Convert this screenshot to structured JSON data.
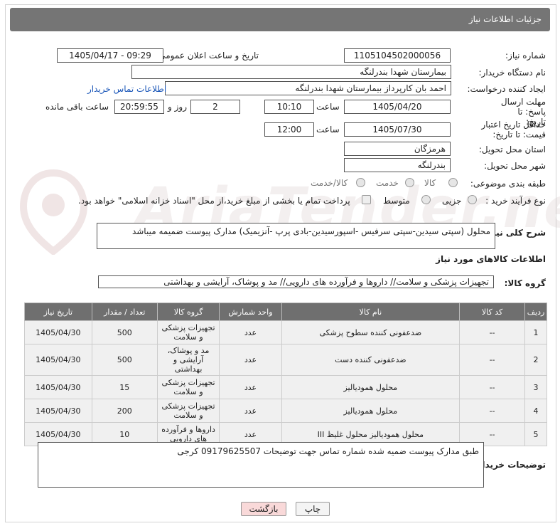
{
  "header": {
    "title": "جزئیات اطلاعات نیاز"
  },
  "form": {
    "need_number": {
      "label": "شماره نیاز:",
      "value": "1105104502000056"
    },
    "announce": {
      "label": "تاریخ و ساعت اعلان عمومی:",
      "value": "1405/04/17 - 09:29"
    },
    "buyer": {
      "label": "نام دستگاه خریدار:",
      "value": "بیمارستان شهدا بندرلنگه"
    },
    "creator": {
      "label": "ایجاد کننده درخواست:",
      "value": "احمد بان کارپرداز بیمارستان شهدا بندرلنگه",
      "contact_link": "اطلاعات تماس خریدار"
    },
    "deadline": {
      "label": "مهلت ارسال پاسخ: تا تاریخ:",
      "date": "1405/04/20",
      "time_label": "ساعت",
      "time": "10:10",
      "days": "2",
      "days_label": "روز و",
      "remaining": "20:59:55",
      "remaining_label": "ساعت باقی مانده"
    },
    "validity": {
      "label": "حداقل تاریخ اعتبار قیمت: تا تاریخ:",
      "date": "1405/07/30",
      "time_label": "ساعت",
      "time": "12:00"
    },
    "province": {
      "label": "استان محل تحویل:",
      "value": "هرمزگان"
    },
    "city": {
      "label": "شهر محل تحویل:",
      "value": "بندرلنگه"
    },
    "category": {
      "label": "طبقه بندی موضوعی:",
      "opt1": "کالا",
      "opt2": "خدمت",
      "opt3": "کالا/خدمت"
    },
    "process": {
      "label": "نوع فرآیند خرید :",
      "opt1": "جزیی",
      "opt2": "متوسط",
      "note": "پرداخت تمام یا بخشی از مبلغ خرید،از محل \"اسناد خزانه اسلامی\" خواهد بود."
    },
    "description": {
      "label": "شرح کلی نیاز:",
      "value": "محلول (سپتی سیدین-سپتی سرفیس -اسپورسیدین-بادی پرپ -آنزیمیک) مدارک پیوست ضمیمه میباشد"
    }
  },
  "items_section": {
    "title": "اطلاعات کالاهای مورد نیاز"
  },
  "goods_group": {
    "label": "گروه کالا:",
    "value": "تجهیزات پزشکی و سلامت// داروها و فرآورده های دارویی// مد و پوشاک، آرایشی و بهداشتی"
  },
  "table": {
    "headers": [
      "ردیف",
      "کد کالا",
      "نام کالا",
      "واحد شمارش",
      "گروه کالا",
      "تعداد / مقدار",
      "تاریخ نیاز"
    ],
    "rows": [
      [
        "1",
        "--",
        "ضدعفونی کننده سطوح پزشکی",
        "عدد",
        "تجهیزات پزشکی و سلامت",
        "500",
        "1405/04/30"
      ],
      [
        "2",
        "--",
        "ضدعفونی کننده دست",
        "عدد",
        "مد و پوشاک، آرایشی و بهداشتی",
        "500",
        "1405/04/30"
      ],
      [
        "3",
        "--",
        "محلول همودیالیز",
        "عدد",
        "تجهیزات پزشکی و سلامت",
        "15",
        "1405/04/30"
      ],
      [
        "4",
        "--",
        "محلول همودیالیز",
        "عدد",
        "تجهیزات پزشکی و سلامت",
        "200",
        "1405/04/30"
      ],
      [
        "5",
        "--",
        "محلول همودیالیز محلول غلیظ III",
        "عدد",
        "داروها و فرآورده های دارویی",
        "10",
        "1405/04/30"
      ]
    ]
  },
  "buyer_notes": {
    "label": "توضیحات خریدار:",
    "value": "طبق مدارک پیوست ضمیه شده  شماره تماس جهت توضیحات 09179625507 کرجی"
  },
  "buttons": {
    "print": "چاپ",
    "back": "بازگشت"
  },
  "watermark": "AriaTender.net"
}
